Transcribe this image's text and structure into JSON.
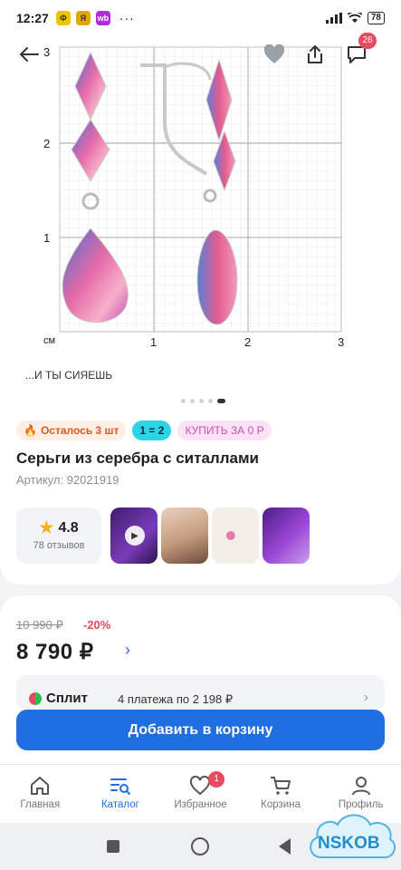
{
  "status_bar": {
    "time": "12:27",
    "dots": "···",
    "battery": "78",
    "app_icons": [
      {
        "icon": "app-icon-yellow",
        "color": "#f2c200",
        "text": "Ф"
      },
      {
        "icon": "app-icon-gold",
        "color": "#e0a800",
        "text": "Я"
      },
      {
        "icon": "app-icon-wb",
        "color": "#b12adf",
        "text": "wb"
      }
    ]
  },
  "top_bar": {
    "cart_badge": "26"
  },
  "gallery": {
    "ruler": {
      "unit_label": "см",
      "x_ticks": [
        "1",
        "2",
        "3"
      ],
      "y_ticks": [
        "1",
        "2",
        "3"
      ]
    },
    "tagline": "...И ТЫ СИЯЕШЬ",
    "slides_count": 5,
    "active_slide": 5
  },
  "chips": {
    "stock": "Осталось 3 шт",
    "promo": "1 = 2",
    "buy": "КУПИТЬ ЗА 0 Р"
  },
  "product": {
    "title": "Серьги из серебра с ситаллами",
    "sku": "Артикул: 92021919"
  },
  "rating": {
    "value": "4.8",
    "count": "78 отзывов"
  },
  "price": {
    "old": "10 990 ₽",
    "discount": "-20%",
    "current": "8 790 ₽"
  },
  "split": {
    "logo": "Сплит",
    "text": "4 платежа по 2 198 ₽"
  },
  "add_to_cart": "Добавить в корзину",
  "tabbar": {
    "items": [
      {
        "label": "Главная",
        "icon": "home-icon"
      },
      {
        "label": "Каталог",
        "icon": "catalog-icon"
      },
      {
        "label": "Избранное",
        "icon": "heart-icon"
      },
      {
        "label": "Корзина",
        "icon": "cart-icon"
      },
      {
        "label": "Профиль",
        "icon": "profile-icon"
      }
    ],
    "favorites_badge": "1"
  },
  "watermark": "NSKOB",
  "colors": {
    "accent": "#1f6fe0",
    "sale": "#e84a5f",
    "stock": "#e2571d",
    "promo": "#2fd3e8",
    "buy": "#d04fb4"
  }
}
